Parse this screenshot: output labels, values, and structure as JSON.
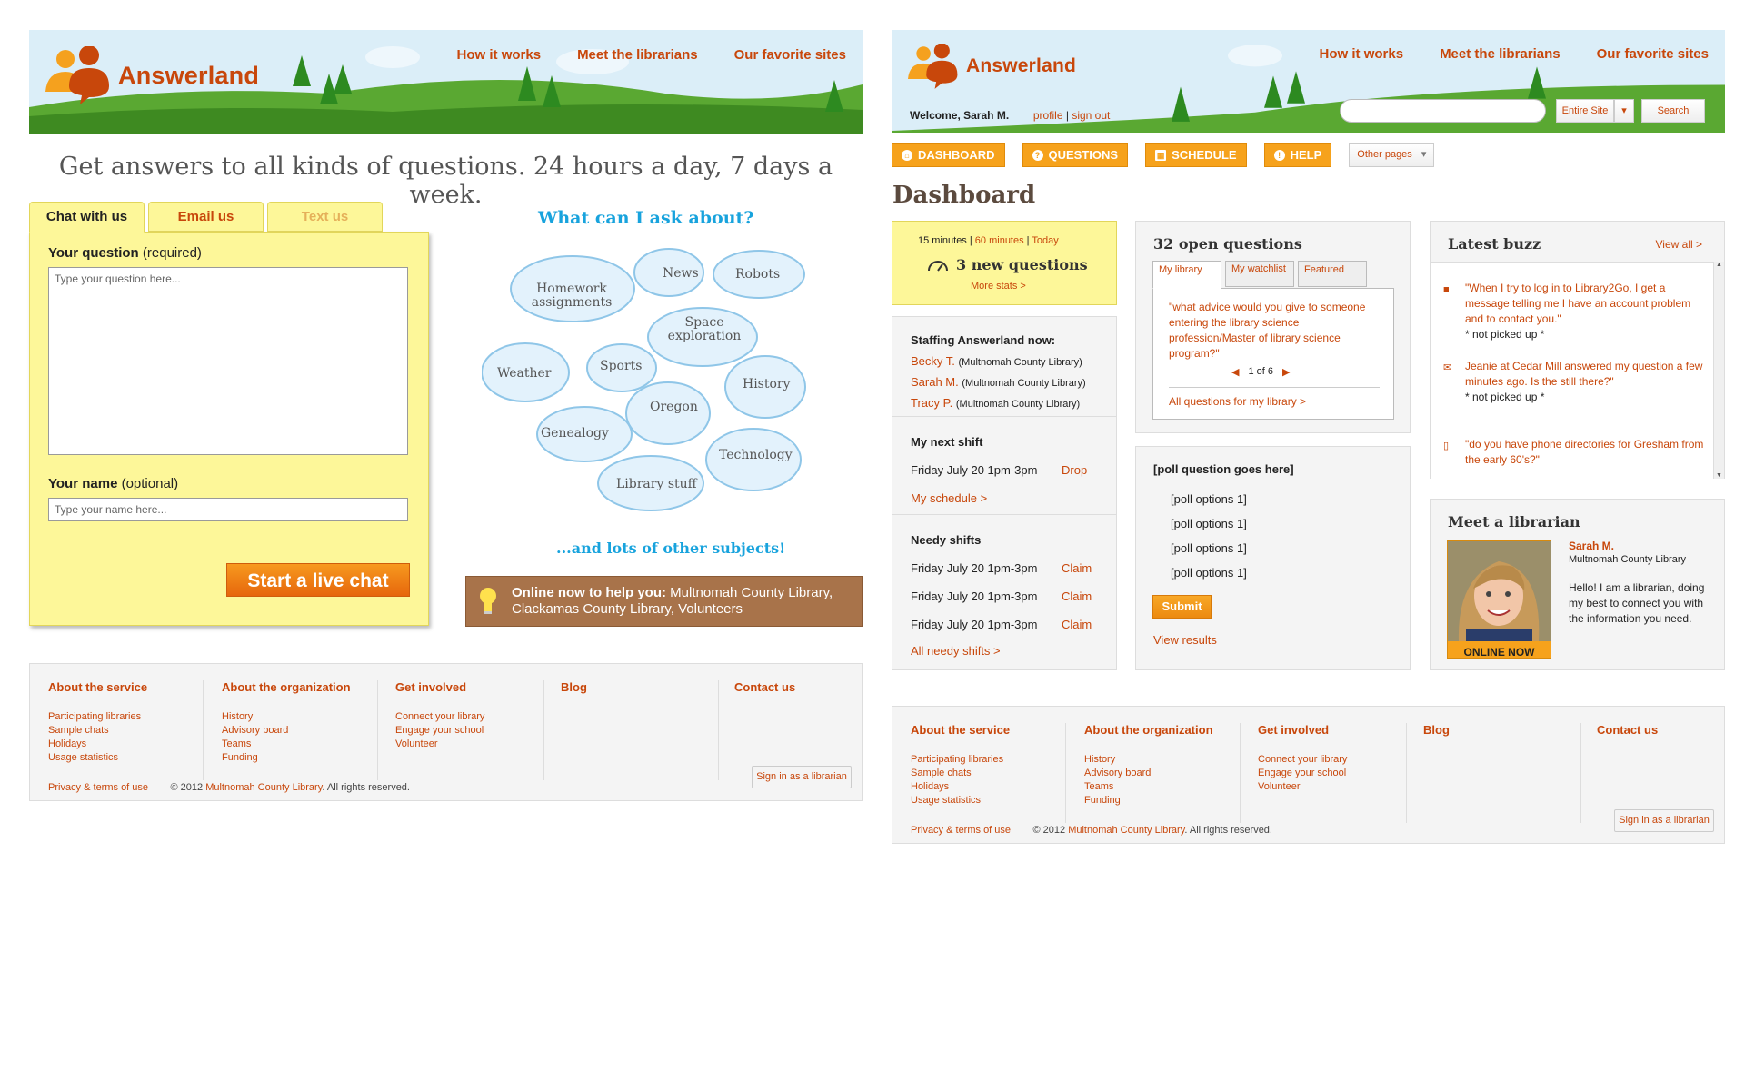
{
  "brand": {
    "name": "Answerland"
  },
  "nav": {
    "how": "How it works",
    "meet": "Meet the librarians",
    "fav": "Our favorite sites"
  },
  "left": {
    "tagline": "Get answers to all kinds of questions. 24 hours a day, 7 days a week.",
    "tabs": [
      "Chat with us",
      "Email us",
      "Text us"
    ],
    "question_label": "Your question",
    "question_hint": "(required)",
    "question_placeholder": "Type your question here...",
    "name_label": "Your name",
    "name_hint": "(optional)",
    "name_placeholder": "Type your name here...",
    "chat_button": "Start a live chat",
    "ask_title": "What can I ask about?",
    "topics": [
      "Homework assignments",
      "News",
      "Robots",
      "Space exploration",
      "Weather",
      "Sports",
      "History",
      "Oregon",
      "Genealogy",
      "Technology",
      "Library stuff"
    ],
    "more_subjects": "...and lots of other subjects!",
    "online_label": "Online now to help you:",
    "online_text": "Multnomah County Library, Clackamas County Library, Volunteers"
  },
  "footer": {
    "cols": [
      {
        "title": "About the service",
        "items": [
          "Participating libraries",
          "Sample chats",
          "Holidays",
          "Usage statistics"
        ]
      },
      {
        "title": "About the organization",
        "items": [
          "History",
          "Advisory board",
          "Teams",
          "Funding"
        ]
      },
      {
        "title": "Get involved",
        "items": [
          "Connect your library",
          "Engage your school",
          "Volunteer"
        ]
      },
      {
        "title": "Blog",
        "items": []
      },
      {
        "title": "Contact us",
        "items": []
      }
    ],
    "privacy": "Privacy & terms of use",
    "copyright_pre": "© 2012",
    "copyright_org": "Multnomah County Library",
    "copyright_post": ". All rights reserved.",
    "signin": "Sign in as a librarian"
  },
  "right": {
    "welcome": "Welcome, Sarah M.",
    "profile": "profile",
    "separator": "|",
    "signout": "sign out",
    "search_scope": "Entire Site",
    "search_button": "Search",
    "menu": [
      "DASHBOARD",
      "QUESTIONS",
      "SCHEDULE",
      "HELP"
    ],
    "other_pages": "Other pages",
    "title": "Dashboard",
    "stats": {
      "t15": "15 minutes",
      "t60": "60 minutes",
      "today": "Today",
      "new": "3 new questions",
      "more": "More stats >"
    },
    "staffing": {
      "title": "Staffing Answerland now:",
      "people": [
        {
          "name": "Becky T.",
          "org": "(Multnomah County Library)"
        },
        {
          "name": "Sarah M.",
          "org": "(Multnomah County Library)"
        },
        {
          "name": "Tracy P.",
          "org": "(Multnomah County Library)"
        }
      ]
    },
    "next_shift": {
      "title": "My next shift",
      "shift": "Friday July 20 1pm-3pm",
      "action": "Drop",
      "link": "My schedule >"
    },
    "needy": {
      "title": "Needy shifts",
      "shifts": [
        "Friday July 20 1pm-3pm",
        "Friday July 20 1pm-3pm",
        "Friday July 20 1pm-3pm"
      ],
      "action": "Claim",
      "link": "All needy shifts >"
    },
    "open": {
      "title": "32 open questions",
      "tabs": [
        "My library",
        "My watchlist",
        "Featured"
      ],
      "question": "\"what advice would you give to someone entering the library science profession/Master of library science program?\"",
      "pager": "1 of 6",
      "link": "All questions for my library >"
    },
    "poll": {
      "title": "[poll question goes here]",
      "options": [
        "[poll options 1]",
        "[poll options 1]",
        "[poll options 1]",
        "[poll options 1]"
      ],
      "submit": "Submit",
      "results": "View results"
    },
    "buzz": {
      "title": "Latest buzz",
      "view_all": "View all >",
      "items": [
        {
          "text": "\"When I try to log in to Library2Go, I get a message telling me I have an account problem and to contact you.\"",
          "note": "* not picked up *"
        },
        {
          "text": "Jeanie at Cedar Mill answered my question a few minutes ago. Is the still there?\"",
          "note": "* not picked up *"
        },
        {
          "text": "\"do you have phone directories for Gresham from the early 60's?\"",
          "note": ""
        }
      ]
    },
    "meet": {
      "title": "Meet a librarian",
      "name": "Sarah M.",
      "org": "Multnomah County Library",
      "bio": "Hello! I am a librarian, doing my best to connect you with the information you need.",
      "status": "ONLINE NOW"
    }
  }
}
